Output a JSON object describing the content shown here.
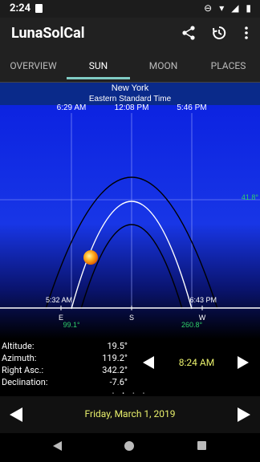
{
  "status": {
    "time": "2:24"
  },
  "appbar": {
    "title": "LunaSolCal"
  },
  "tabs": [
    {
      "label": "OVERVIEW",
      "active": false
    },
    {
      "label": "SUN",
      "active": true
    },
    {
      "label": "MOON",
      "active": false
    },
    {
      "label": "PLACES",
      "active": false
    }
  ],
  "plot": {
    "city": "New York",
    "timezone": "Eastern Standard Time",
    "top_times": [
      "6:29 AM",
      "12:08 PM",
      "5:46 PM"
    ],
    "bottom_left_time": "5:32 AM",
    "bottom_right_time": "6:43 PM",
    "max_alt": "41.8°",
    "dir_e": "E",
    "dir_s": "S",
    "dir_w": "W",
    "az_rise": "99.1°",
    "az_set": "260.8°"
  },
  "info": {
    "altitude_label": "Altitude:",
    "altitude": "19.5°",
    "azimuth_label": "Azimuth:",
    "azimuth": "119.2°",
    "ra_label": "Right Asc.:",
    "ra": "342.2°",
    "dec_label": "Declination:",
    "dec": "-7.6°",
    "time": "8:24 AM"
  },
  "date": "Friday, March 1, 2019"
}
